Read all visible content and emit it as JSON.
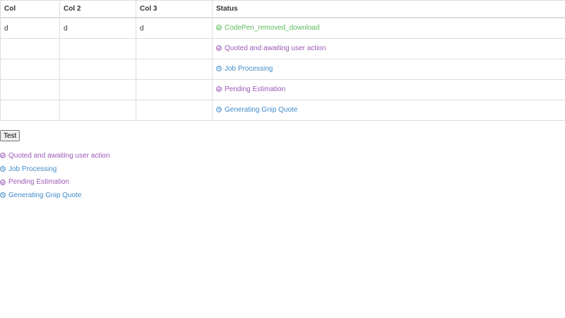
{
  "table": {
    "headers": [
      "Col",
      "Col 2",
      "Col 3",
      "Status"
    ],
    "rows": [
      {
        "col1": "d",
        "col2": "d",
        "col3": "d",
        "status": "CodePen_removed_download",
        "status_color": "green"
      },
      {
        "col1": "",
        "col2": "",
        "col3": "",
        "status": "Quoted and awaiting user action",
        "status_color": "purple"
      },
      {
        "col1": "",
        "col2": "",
        "col3": "",
        "status": "Job Processing",
        "status_color": "blue"
      },
      {
        "col1": "",
        "col2": "",
        "col3": "",
        "status": "Pending Estimation",
        "status_color": "purple"
      },
      {
        "col1": "",
        "col2": "",
        "col3": "",
        "status": "Generating Gnip Quote",
        "status_color": "blue"
      }
    ]
  },
  "test_button": {
    "label": "Test"
  },
  "status_list": [
    {
      "label": "Quoted and awaiting user action",
      "status_color": "purple"
    },
    {
      "label": "Job Processing",
      "status_color": "blue"
    },
    {
      "label": "Pending Estimation",
      "status_color": "purple"
    },
    {
      "label": "Generating Gnip Quote",
      "status_color": "blue"
    }
  ],
  "colors": {
    "green": "#5cb85c",
    "purple": "#9b59b6",
    "blue": "#428bca",
    "border": "#dddddd"
  },
  "icons": {
    "green": "check-circle-icon",
    "purple": "check-circle-icon",
    "blue": "clock-icon"
  }
}
